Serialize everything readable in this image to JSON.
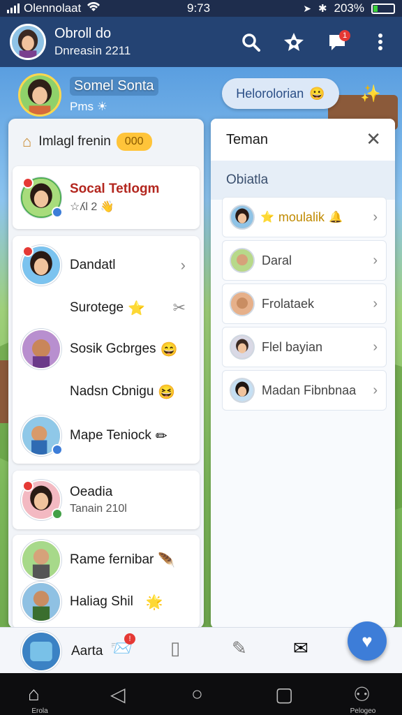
{
  "status_bar": {
    "carrier": "Olennolaat",
    "time": "9:73",
    "battery": "203%",
    "battery_level": 0.2
  },
  "app_header": {
    "title": "Obroll do",
    "subtitle": "Dnreasin 2211",
    "notification_count": "1",
    "icons": [
      "search-icon",
      "star-settings-icon",
      "chat-icon",
      "more-vert-icon"
    ]
  },
  "profile": {
    "name": "Somel Sonta",
    "status": "Pms",
    "pill_label": "Helorolorian"
  },
  "left_panel": {
    "header_title": "Imlagl frenin",
    "header_badge": "000",
    "items": [
      {
        "label": "Socal Tetlogm",
        "sub": "☆ʎl 2"
      },
      {
        "label": "Dandatl"
      },
      {
        "label": "Surotege"
      },
      {
        "label": "Sosik Gcbrges"
      },
      {
        "label": "Nadsn Cbnigu"
      },
      {
        "label": "Mape Teniock"
      },
      {
        "label": "Oeadia",
        "sub": "Tanain 210l"
      },
      {
        "label": "Rame fernibar"
      },
      {
        "label": "Haliag Shil"
      },
      {
        "label": "Aarta"
      }
    ]
  },
  "right_panel": {
    "title": "Teman",
    "section": "Obiatla",
    "friends": [
      {
        "name": "moulalik"
      },
      {
        "name": "Daral"
      },
      {
        "name": "Frolataek"
      },
      {
        "name": "Flel bayian"
      },
      {
        "name": "Madan Fibnbnaa"
      }
    ]
  },
  "bottom_nav": {
    "home_label": "Erola",
    "profile_label": "Pelogeo"
  },
  "colors": {
    "header_bg": "#244373",
    "accent": "#3d7dd8",
    "badge": "#ffc43a",
    "title_red": "#b3261e"
  }
}
